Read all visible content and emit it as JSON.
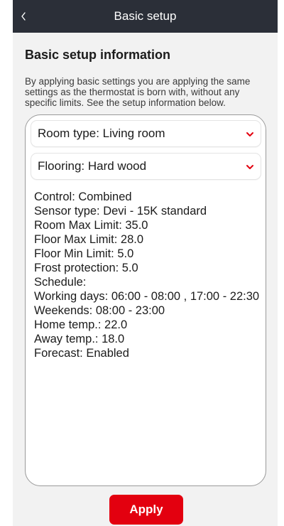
{
  "header": {
    "title": "Basic setup",
    "back_icon": "chevron-left-icon"
  },
  "main": {
    "section_title": "Basic setup information",
    "description": "By applying basic settings you are applying the same settings as the thermostat is born with, without any specific limits. See the setup information below.",
    "dropdowns": [
      {
        "label": "Room type: Living room",
        "icon": "chevron-down-icon"
      },
      {
        "label": "Flooring: Hard wood",
        "icon": "chevron-down-icon"
      }
    ],
    "info_lines": [
      "Control: Combined",
      "Sensor type: Devi - 15K standard",
      "Room Max Limit: 35.0",
      "Floor Max Limit: 28.0",
      "Floor Min Limit: 5.0",
      "Frost protection: 5.0",
      "Schedule:",
      "Working days: 06:00 - 08:00 , 17:00 - 22:30",
      "Weekends: 08:00 - 23:00",
      "Home temp.: 22.0",
      "Away temp.: 18.0",
      "Forecast: Enabled"
    ],
    "apply_label": "Apply"
  },
  "colors": {
    "header_bg": "#2b2f38",
    "accent_red": "#e3000f",
    "page_bg": "#f2f2f2",
    "panel_bg": "#ffffff"
  }
}
